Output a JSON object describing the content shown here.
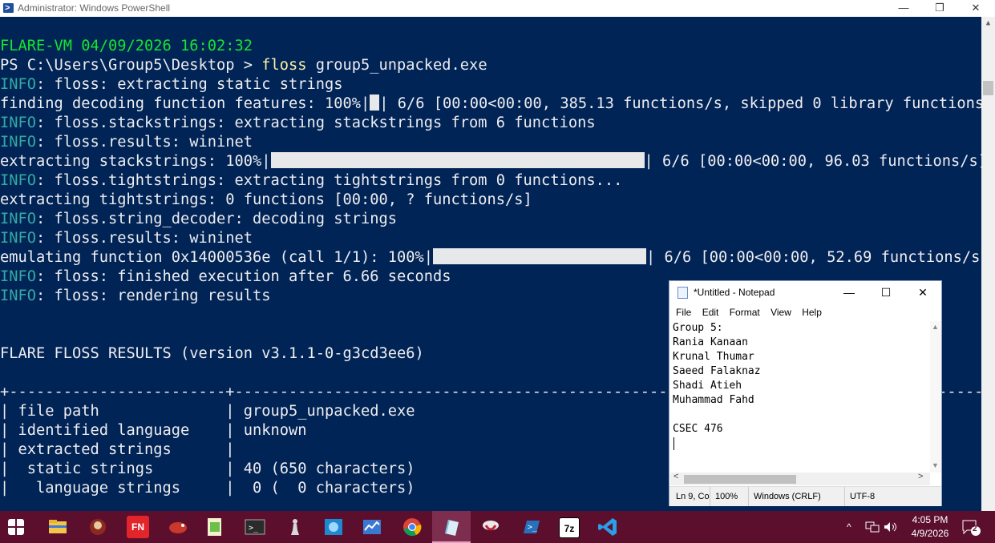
{
  "window": {
    "title": "Administrator: Windows PowerShell",
    "minimize_glyph": "—",
    "maximize_glyph": "❐",
    "close_glyph": "✕"
  },
  "terminal": {
    "header": "FLARE-VM 04/09/2026 16:02:32",
    "prompt": "PS C:\\Users\\Group5\\Desktop > ",
    "command": "floss",
    "command_args": " group5_unpacked.exe",
    "info_tag": "INFO",
    "lines": {
      "l1": ": floss: extracting static strings",
      "l2_pre": "finding decoding function features: 100%|",
      "l2_post": "| 6/6 [00:00<00:00, 385.13 functions/s, skipped 0 library functions]",
      "l3": ": floss.stackstrings: extracting stackstrings from 6 functions",
      "l4": ": floss.results: wininet",
      "l5_pre": "extracting stackstrings: 100%|",
      "l5_post": "| 6/6 [00:00<00:00, 96.03 functions/s]",
      "l6": ": floss.tightstrings: extracting tightstrings from 0 functions...",
      "l7": "extracting tightstrings: 0 functions [00:00, ? functions/s]",
      "l8": ": floss.string_decoder: decoding strings",
      "l9": ": floss.results: wininet",
      "l10_pre": "emulating function 0x14000536e (call 1/1): 100%|",
      "l10_post": "| 6/6 [00:00<00:00, 52.69 functions/s]",
      "l11": ": floss: finished execution after 6.66 seconds",
      "l12": ": floss: rendering results",
      "results_title": "FLARE FLOSS RESULTS (version v3.1.1-0-g3cd3ee6)",
      "border": "+------------------------+------------------------------------------------------------------------------------------+",
      "row1": "| file path              | group5_unpacked.exe                                                                      |",
      "row2": "| identified language    | unknown                                                                                  |",
      "row3": "| extracted strings      |                                                                                          |",
      "row4": "|  static strings        | 40 (650 characters)                                                                      |",
      "row5": "|   language strings     |  0 (  0 characters)                                                                      |"
    }
  },
  "notepad": {
    "title": "*Untitled - Notepad",
    "menu": [
      "File",
      "Edit",
      "Format",
      "View",
      "Help"
    ],
    "lines": [
      "Group 5:",
      "Rania Kanaan",
      "Krunal Thumar",
      "Saeed Falaknaz",
      "Shadi Atieh",
      "Muhammad Fahd",
      "",
      "CSEC 476"
    ],
    "status": {
      "position": "Ln 9, Co",
      "zoom": "100%",
      "line_ending": "Windows (CRLF)",
      "encoding": "UTF-8"
    }
  },
  "taskbar": {
    "time": "4:05 PM",
    "date": "4/9/2026",
    "notification_count": "2",
    "app_labels": {
      "fn": "FN",
      "zip": "7z"
    }
  }
}
